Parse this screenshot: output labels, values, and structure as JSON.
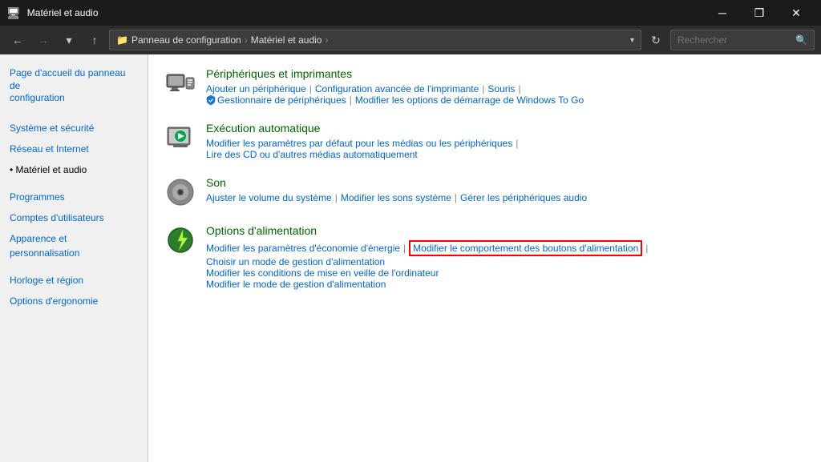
{
  "titlebar": {
    "title": "Matériel et audio",
    "icon": "⚙",
    "minimize": "─",
    "restore": "❐",
    "close": "✕"
  },
  "navbar": {
    "back": "←",
    "forward": "→",
    "down": "▾",
    "up": "↑",
    "breadcrumb": [
      {
        "label": "Panneau de configuration"
      },
      {
        "label": "Matériel et audio"
      },
      {
        "label": ""
      }
    ],
    "refresh": "↻",
    "search_placeholder": "Rechercher",
    "search_icon": "🔍"
  },
  "sidebar": {
    "items": [
      {
        "id": "accueil",
        "label": "Page d'accueil du panneau de configuration",
        "active": false
      },
      {
        "id": "systeme",
        "label": "Système et sécurité",
        "active": false
      },
      {
        "id": "reseau",
        "label": "Réseau et Internet",
        "active": false
      },
      {
        "id": "materiel",
        "label": "Matériel et audio",
        "active": true
      },
      {
        "id": "programmes",
        "label": "Programmes",
        "active": false
      },
      {
        "id": "comptes",
        "label": "Comptes d'utilisateurs",
        "active": false
      },
      {
        "id": "apparence",
        "label": "Apparence et personnalisation",
        "active": false
      },
      {
        "id": "horloge",
        "label": "Horloge et région",
        "active": false
      },
      {
        "id": "ergonomie",
        "label": "Options d'ergonomie",
        "active": false
      }
    ]
  },
  "content": {
    "sections": [
      {
        "id": "peripheriques",
        "title": "Périphériques et imprimantes",
        "links_row1": [
          {
            "label": "Ajouter un périphérique",
            "sep": true
          },
          {
            "label": "Configuration avancée de l'imprimante",
            "sep": true
          },
          {
            "label": "Souris",
            "sep": false
          }
        ],
        "links_row2": [
          {
            "label": "Gestionnaire de périphériques",
            "sep": true,
            "shield": true
          },
          {
            "label": "Modifier les options de démarrage de Windows To Go",
            "sep": false
          }
        ]
      },
      {
        "id": "execution",
        "title": "Exécution automatique",
        "links_row1": [
          {
            "label": "Modifier les paramètres par défaut pour les médias ou les périphériques",
            "sep": false
          }
        ],
        "links_row2": [
          {
            "label": "Lire des CD ou d'autres médias automatiquement",
            "sep": false
          }
        ]
      },
      {
        "id": "son",
        "title": "Son",
        "links_row1": [
          {
            "label": "Ajuster le volume du système",
            "sep": true
          },
          {
            "label": "Modifier les sons système",
            "sep": true
          },
          {
            "label": "Gérer les périphériques audio",
            "sep": false
          }
        ]
      },
      {
        "id": "alimentation",
        "title": "Options d'alimentation",
        "links_row1": [
          {
            "label": "Modifier les paramètres d'économie d'énergie",
            "sep": true
          },
          {
            "label": "Modifier le comportement des boutons d'alimentation",
            "sep": true,
            "highlighted": true
          },
          {
            "label": "Choisir un mode de gestion d'alimentation",
            "sep": false
          }
        ],
        "links_row2": [
          {
            "label": "Modifier les conditions de mise en veille de l'ordinateur",
            "sep": false
          }
        ],
        "links_row3": [
          {
            "label": "Modifier le mode de gestion d'alimentation",
            "sep": false
          }
        ]
      }
    ]
  }
}
